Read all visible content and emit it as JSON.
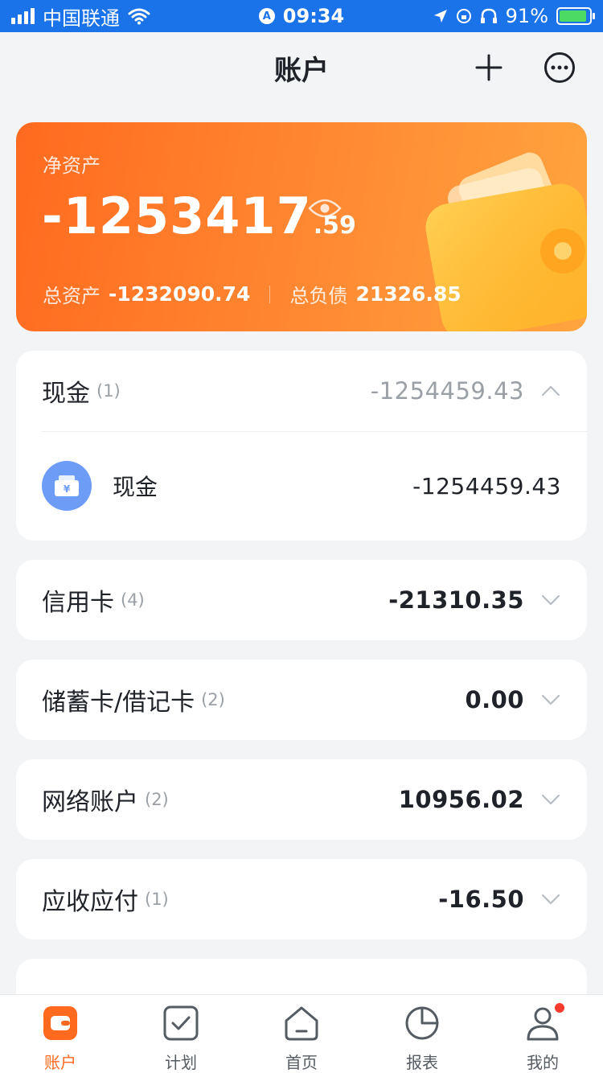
{
  "status_bar": {
    "carrier": "中国联通",
    "time": "09:34",
    "battery": "91%",
    "battery_level": 0.91
  },
  "header": {
    "title": "账户"
  },
  "summary": {
    "label": "净资产",
    "net_int": "-1253417",
    "net_dec": ".59",
    "total_assets_label": "总资产",
    "total_assets": "-1232090.74",
    "total_liab_label": "总负债",
    "total_liab": "21326.85"
  },
  "groups": [
    {
      "title": "现金",
      "count": "(1)",
      "amount": "-1254459.43",
      "expanded": true,
      "accounts": [
        {
          "name": "现金",
          "amount": "-1254459.43",
          "icon": "cash-icon"
        }
      ]
    },
    {
      "title": "信用卡",
      "count": "(4)",
      "amount": "-21310.35",
      "expanded": false
    },
    {
      "title": "储蓄卡/借记卡",
      "count": "(2)",
      "amount": "0.00",
      "expanded": false
    },
    {
      "title": "网络账户",
      "count": "(2)",
      "amount": "10956.02",
      "expanded": false
    },
    {
      "title": "应收应付",
      "count": "(1)",
      "amount": "-16.50",
      "expanded": false
    }
  ],
  "tabs": [
    {
      "label": "账户",
      "icon": "wallet-icon",
      "active": true
    },
    {
      "label": "计划",
      "icon": "checkbox-icon",
      "active": false
    },
    {
      "label": "首页",
      "icon": "home-icon",
      "active": false
    },
    {
      "label": "报表",
      "icon": "pie-chart-icon",
      "active": false
    },
    {
      "label": "我的",
      "icon": "user-icon",
      "active": false,
      "badge": true
    }
  ],
  "colors": {
    "accent": "#ff6a1f",
    "status_bar": "#1a73e8",
    "cash_icon": "#6c9cf5"
  }
}
